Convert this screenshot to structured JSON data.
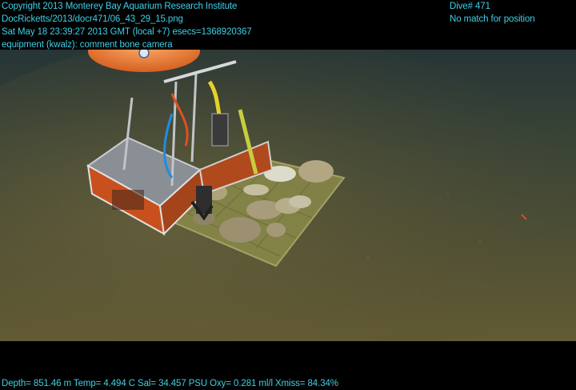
{
  "header_left": {
    "line1": "Copyright 2013 Monterey Bay Aquarium Research Institute",
    "line2": "DocRicketts/2013/docr471/06_43_29_15.png",
    "line3": "Sat May 18 23:39:27 2013 GMT (local +7)  esecs=1368920367",
    "line4": "equipment (kwalz): comment bone camera"
  },
  "header_right": {
    "line1": "Dive# 471",
    "line2": "No match for position"
  },
  "footer": {
    "telemetry": "Depth= 851.46 m  Temp= 4.494 C  Sal= 34.457 PSU  Oxy= 0.281 ml/l  Xmiss= 84.34%"
  },
  "colors": {
    "overlay_text": "#3fd0e6",
    "seafloor": "#5e5632",
    "water": "#2a3a3c",
    "float": "#f07a2a",
    "frame_orange": "#c8501c"
  }
}
